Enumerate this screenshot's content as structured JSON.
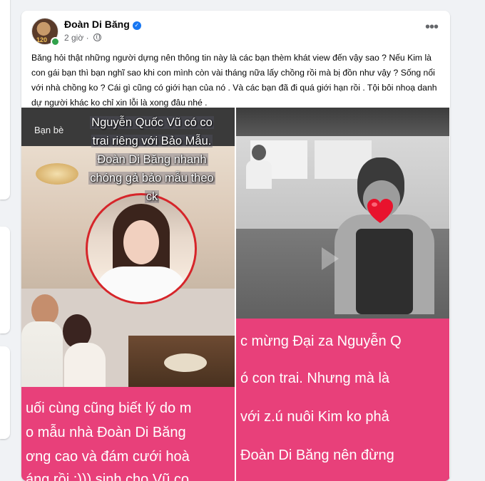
{
  "post": {
    "author": "Đoàn Di Băng",
    "avatar_badge": "120",
    "time": "2 giờ",
    "separator": "·",
    "text": "Băng hỏi thật những người dựng nên thông tin này là các bạn thèm khát view đến vậy sao ? Nếu Kim là con gái bạn thì bạn nghĩ sao khi con mình còn vài tháng nữa lấy chồng rồi mà bị đồn như vậy ? Sống nổi với nhà chồng ko ? Cái gì cũng có giới hạn của nó . Và các bạn đã đi quá giới hạn rồi . Tội bôi nhoạ danh dự người khác ko chỉ xin lỗi là xong đâu nhé .",
    "more_icon": "more-horizontal-icon",
    "verified_icon": "verified-badge-icon",
    "audience_icon": "globe-icon"
  },
  "media": {
    "left": {
      "tab": "Bạn bè",
      "overlay": [
        "Nguyễn Quốc Vũ có co",
        "trai riêng với Bảo Mẫu.",
        "Đoàn Di Băng nhanh",
        "chóng gả bảo mẫu theo",
        "ck"
      ],
      "caption": [
        "uối cùng cũng biết lý do m",
        "o mẫu nhà Đoàn Di Băng",
        "ơng cao và đám cưới hoà",
        "áng rồi :))) sinh cho Vũ co"
      ]
    },
    "right": {
      "caption": [
        "c mừng Đại za Nguyễn Q",
        "ó con trai. Nhưng mà là",
        "với z.ú nuôi Kim ko phả",
        "Đoàn Di Băng nên đừng"
      ],
      "heart_icon": "red-heart-emoji-icon"
    }
  },
  "colors": {
    "pink_band": "#e8407a",
    "facebook_blue": "#1877f2",
    "online_green": "#31a24c"
  }
}
